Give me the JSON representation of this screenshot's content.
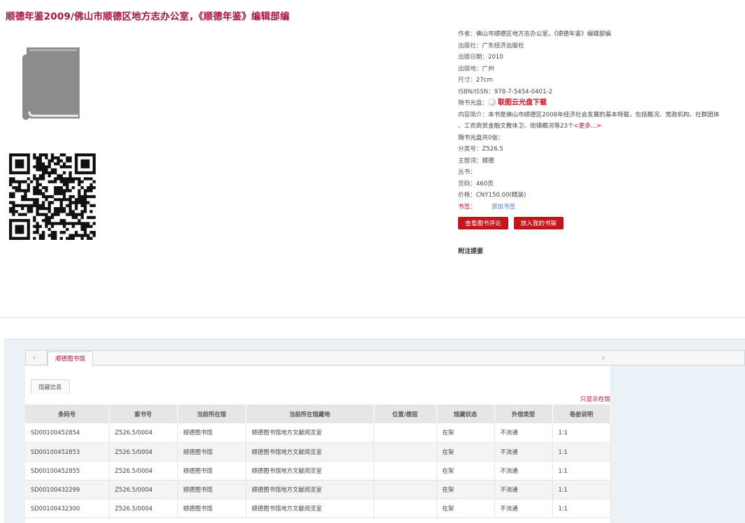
{
  "title": "顺德年鉴2009/佛山市顺德区地方志办公室，《顺德年鉴》编辑部编",
  "icons": {
    "book": "book-icon",
    "qr": "qr-code-icon",
    "disc": "disc-icon"
  },
  "colors": {
    "title": "#a8113a",
    "button": "#c4161c",
    "link": "#4a7fc0",
    "alert": "#c0102c"
  },
  "info": {
    "author_label": "作者：",
    "author": "佛山市顺德区地方志办公室，《顺德年鉴》编辑部编",
    "publisher_label": "出版社：",
    "publisher": "广东经济出版社",
    "date_label": "出版日期：",
    "date": "2010",
    "place_label": "出版地：",
    "place": "广州",
    "size_label": "尺寸：",
    "size": "27cm",
    "isbn_label": "ISBN/ISSN：",
    "isbn": "978-7-5454-0401-2",
    "disc_label": "随书光盘：",
    "disc_link": "联图云光盘下载",
    "summary_label": "内容简介：",
    "summary_line1": "本书是佛山市顺德区2008年经济社会发展的基本特载，包括概况、党政机构、社群团体",
    "summary_line2": "、工农商贸金融文教体卫、街镇概况等23个",
    "summary_more": "<更多...>",
    "disc_count": "随书光盘共0张：",
    "class_label": "分类号：",
    "class_no": "Z526.5",
    "subject_label": "主题词：",
    "subject": "顺德",
    "series_label": "丛书：",
    "series": "",
    "pages_label": "页码：",
    "pages": "460页",
    "price_label": "价格：",
    "price": "CNY150.00(精装)",
    "tags_label": "书签：",
    "tags_link": "添加书签"
  },
  "buttons": {
    "review": "查看图书评论",
    "shelf": "放入我的书架"
  },
  "note_heading": "附注提要",
  "tabs": {
    "left_arrow": "‹",
    "right_arrow": "›",
    "library": "顺德图书馆",
    "holdings": "馆藏信息"
  },
  "show_only": "只显示在馆",
  "table": {
    "headers": [
      "条码号",
      "索书号",
      "当前所在馆",
      "当前所在馆藏地",
      "位置/楼层",
      "馆藏状态",
      "外借类型",
      "卷册说明"
    ],
    "rows": [
      [
        "SD00100452854",
        "Z526.5/0004",
        "顺德图书馆",
        "顺德图书馆地方文献阅览室",
        "",
        "在架",
        "不流通",
        "1:1"
      ],
      [
        "SD00100452853",
        "Z526.5/0004",
        "顺德图书馆",
        "顺德图书馆地方文献阅览室",
        "",
        "在架",
        "不流通",
        "1:1"
      ],
      [
        "SD00100452855",
        "Z526.5/0004",
        "顺德图书馆",
        "顺德图书馆地方文献阅览室",
        "",
        "在架",
        "不流通",
        "1:1"
      ],
      [
        "SD00100432299",
        "Z526.5/0004",
        "顺德图书馆",
        "顺德图书馆地方文献阅览室",
        "",
        "在架",
        "不流通",
        "1:1"
      ],
      [
        "SD00100432300",
        "Z526.5/0004",
        "顺德图书馆",
        "顺德图书馆地方文献阅览室",
        "",
        "在架",
        "不流通",
        "1:1"
      ]
    ]
  }
}
